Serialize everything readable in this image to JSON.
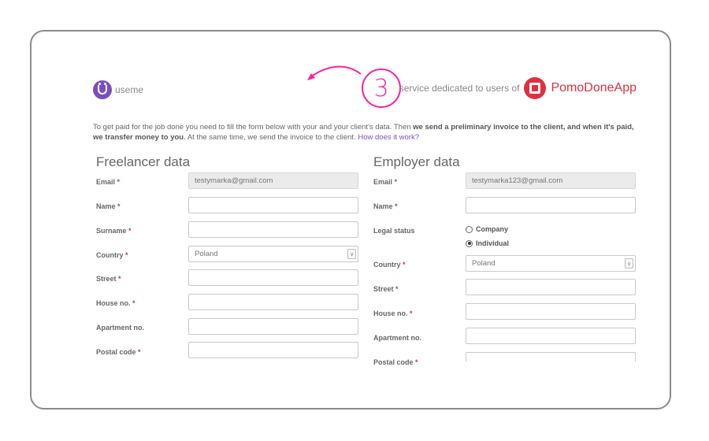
{
  "header": {
    "logo_text": "useme",
    "step_number": "3",
    "service_text": "service dedicated to users of",
    "partner_name": "PomoDoneApp"
  },
  "intro": {
    "part1": "To get paid for the job done you need to fill the form below with your and your client's data. Then ",
    "bold1": "we send a preliminary invoice to the client, and when it's paid, we transfer money to you",
    "part2": ". At the same time, we send the invoice to the client. ",
    "link": "How does it work?"
  },
  "freelancer": {
    "title": "Freelancer data",
    "email_label": "Email",
    "email_value": "testymarka@gmail.com",
    "name_label": "Name",
    "surname_label": "Surname",
    "country_label": "Country",
    "country_value": "Poland",
    "street_label": "Street",
    "house_label": "House no.",
    "apartment_label": "Apartment no.",
    "postal_label": "Postal code",
    "required_mark": "*"
  },
  "employer": {
    "title": "Employer data",
    "email_label": "Email",
    "email_value": "testymarka123@gmail.com",
    "name_label": "Name",
    "legal_label": "Legal status",
    "legal_options": [
      "Company",
      "Individual"
    ],
    "legal_selected": "Individual",
    "country_label": "Country",
    "country_value": "Poland",
    "street_label": "Street",
    "house_label": "House no.",
    "apartment_label": "Apartment no.",
    "postal_label": "Postal code",
    "required_mark": "*"
  },
  "colors": {
    "brand_purple": "#7c4dbf",
    "accent_pink": "#ff1fa0",
    "pomodone_red": "#e0303f"
  }
}
